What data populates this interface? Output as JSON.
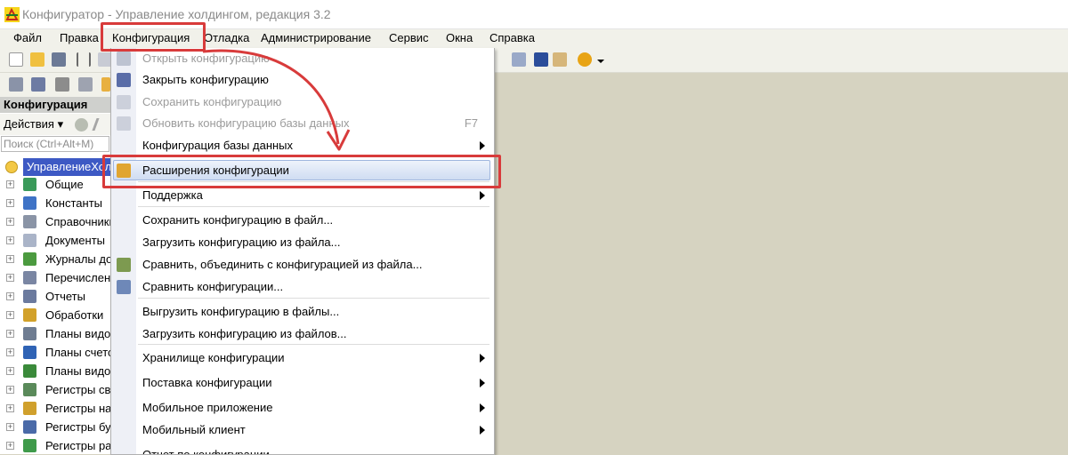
{
  "window": {
    "title": "Конфигуратор - Управление холдингом, редакция 3.2"
  },
  "menubar": {
    "items": [
      {
        "label": "Файл"
      },
      {
        "label": "Правка"
      },
      {
        "label": "Конфигурация"
      },
      {
        "label": "Отладка"
      },
      {
        "label": "Администрирование"
      },
      {
        "label": "Сервис"
      },
      {
        "label": "Окна"
      },
      {
        "label": "Справка"
      }
    ]
  },
  "left_panel": {
    "header": "Конфигурация",
    "actions_label": "Действия",
    "search_placeholder": "Поиск (Ctrl+Alt+M)",
    "root": "УправлениеХолдингом",
    "tree": [
      {
        "label": "Общие",
        "icon": "common-icon"
      },
      {
        "label": "Константы",
        "icon": "constants-icon"
      },
      {
        "label": "Справочники",
        "icon": "catalogs-icon"
      },
      {
        "label": "Документы",
        "icon": "documents-icon"
      },
      {
        "label": "Журналы документов",
        "icon": "journals-icon"
      },
      {
        "label": "Перечисления",
        "icon": "enums-icon"
      },
      {
        "label": "Отчеты",
        "icon": "reports-icon"
      },
      {
        "label": "Обработки",
        "icon": "processing-icon"
      },
      {
        "label": "Планы видов характеристик",
        "icon": "chart-types-icon"
      },
      {
        "label": "Планы счетов",
        "icon": "accounts-icon"
      },
      {
        "label": "Планы видов расчета",
        "icon": "calc-types-icon"
      },
      {
        "label": "Регистры сведений",
        "icon": "info-registers-icon"
      },
      {
        "label": "Регистры накопления",
        "icon": "accum-registers-icon"
      },
      {
        "label": "Регистры бухгалтерии",
        "icon": "account-registers-icon"
      },
      {
        "label": "Регистры расчета",
        "icon": "calc-registers-icon"
      }
    ]
  },
  "menu": {
    "items": [
      {
        "label": "Открыть конфигурацию",
        "disabled": true,
        "shortcut": "",
        "submenu": false
      },
      {
        "label": "Закрыть конфигурацию",
        "disabled": false,
        "shortcut": "",
        "submenu": false
      },
      {
        "label": "Сохранить конфигурацию",
        "disabled": true,
        "shortcut": "",
        "submenu": false
      },
      {
        "label": "Обновить конфигурацию базы данных",
        "disabled": true,
        "shortcut": "F7",
        "submenu": false
      },
      {
        "label": "Конфигурация базы данных",
        "disabled": false,
        "shortcut": "",
        "submenu": true
      },
      {
        "label": "Расширения конфигурации",
        "disabled": false,
        "shortcut": "",
        "submenu": false,
        "selected": true
      },
      {
        "label": "Поддержка",
        "disabled": false,
        "shortcut": "",
        "submenu": true
      },
      {
        "label": "Сохранить конфигурацию в файл...",
        "disabled": false,
        "shortcut": "",
        "submenu": false
      },
      {
        "label": "Загрузить конфигурацию из файла...",
        "disabled": false,
        "shortcut": "",
        "submenu": false
      },
      {
        "label": "Сравнить, объединить с конфигурацией из файла...",
        "disabled": false,
        "shortcut": "",
        "submenu": false
      },
      {
        "label": "Сравнить конфигурации...",
        "disabled": false,
        "shortcut": "",
        "submenu": false
      },
      {
        "label": "Выгрузить конфигурацию в файлы...",
        "disabled": false,
        "shortcut": "",
        "submenu": false
      },
      {
        "label": "Загрузить конфигурацию из файлов...",
        "disabled": false,
        "shortcut": "",
        "submenu": false
      },
      {
        "label": "Хранилище конфигурации",
        "disabled": false,
        "shortcut": "",
        "submenu": true
      },
      {
        "label": "Поставка конфигурации",
        "disabled": false,
        "shortcut": "",
        "submenu": true
      },
      {
        "label": "Мобильное приложение",
        "disabled": false,
        "shortcut": "",
        "submenu": true
      },
      {
        "label": "Мобильный клиент",
        "disabled": false,
        "shortcut": "",
        "submenu": true
      },
      {
        "label": "Отчет по конфигурации...",
        "disabled": false,
        "shortcut": "",
        "submenu": false
      }
    ]
  },
  "colors": {
    "highlight": "#d83b3b",
    "selection": "#3d59c4",
    "workspace": "#d6d3c1"
  }
}
